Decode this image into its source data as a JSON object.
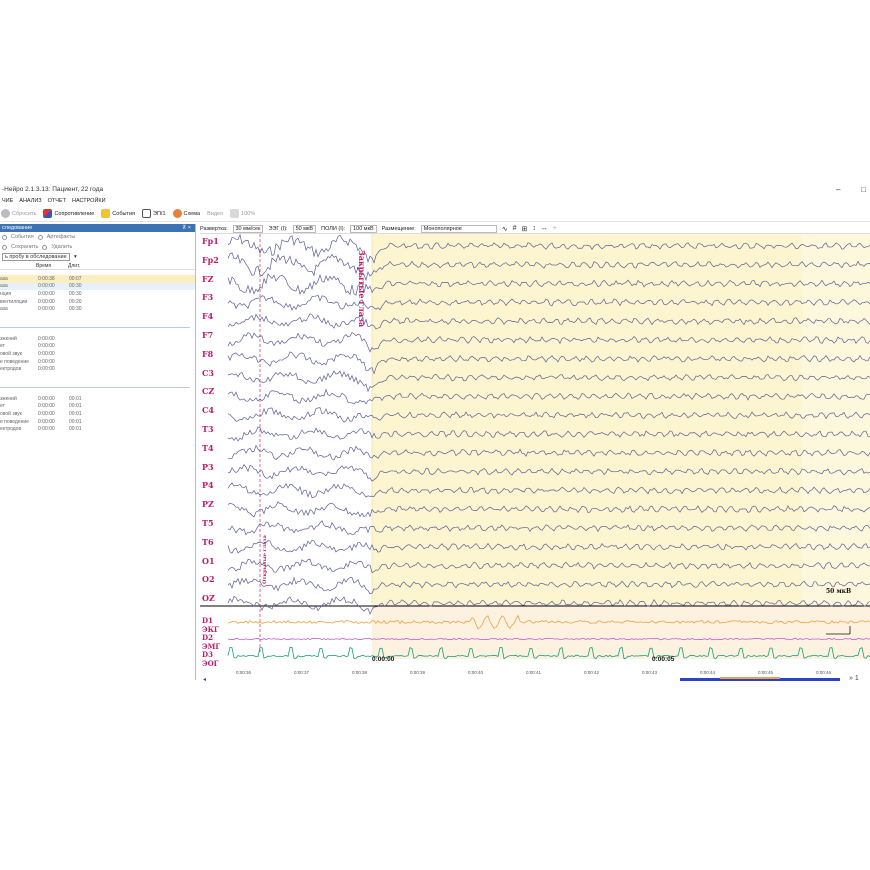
{
  "window": {
    "title": "-Нейро 2.1.3.13: Пациент, 22 года",
    "controls": [
      "–",
      "□"
    ]
  },
  "menu": [
    "ЧИЕ",
    "АНАЛИЗ",
    "ОТЧЕТ",
    "НАСТРОЙКИ"
  ],
  "toolbar": {
    "reset": "Сбросить",
    "impedance": "Сопротивление",
    "events": "События",
    "evp": "ЭП/1",
    "scheme": "Схема",
    "video": "Видео",
    "zoom": "100%"
  },
  "left_panel": {
    "header": "следование",
    "pin": "⊼ ×",
    "filters": [
      "События",
      "Артефакты"
    ],
    "actions": [
      "Сохранить",
      "Удалить"
    ],
    "add_button": "ь пробу в обследование",
    "columns": [
      "",
      "Время",
      "Длит."
    ],
    "group1": [
      {
        "name": "аза",
        "time": "0:00:38",
        "dur": "00:07",
        "state": "sel"
      },
      {
        "name": "аза",
        "time": "0:00:00",
        "dur": "00:30",
        "state": "sel2"
      },
      {
        "name": "нция",
        "time": "0:00:00",
        "dur": "00:30",
        "state": ""
      },
      {
        "name": "вентиляции",
        "time": "0:00:00",
        "dur": "00:20",
        "state": ""
      },
      {
        "name": "аза",
        "time": "0:00:00",
        "dur": "00:30",
        "state": ""
      }
    ],
    "group2": [
      {
        "name": "зжений",
        "time": "0:00:00"
      },
      {
        "name": "ет",
        "time": "0:00:00"
      },
      {
        "name": "овой звук",
        "time": "0:00:00"
      },
      {
        "name": "е поведение",
        "time": "0:00:00"
      },
      {
        "name": "ектродов",
        "time": "0:00:00"
      }
    ],
    "group3": [
      {
        "name": "зжений",
        "time": "0:00:00",
        "dur": "00:01"
      },
      {
        "name": "ет",
        "time": "0:00:00",
        "dur": "00:01"
      },
      {
        "name": "овой звук",
        "time": "0:00:00",
        "dur": "00:01"
      },
      {
        "name": "е поведение",
        "time": "0:00:00",
        "dur": "00:01"
      },
      {
        "name": "ектродов",
        "time": "0:00:00",
        "dur": "00:01"
      }
    ]
  },
  "controls": {
    "sweep_label": "Развертка:",
    "sweep_value": "30 мм/сек",
    "eeg_label": "ЭЭГ (I):",
    "eeg_value": "50 мкВ",
    "poly_label": "ПОЛИ (I):",
    "poly_value": "100 мкВ",
    "montage_label": "Размещение:",
    "montage_value": "Монополярное"
  },
  "channels": [
    "Fp1",
    "Fp2",
    "FZ",
    "F3",
    "F4",
    "F7",
    "F8",
    "C3",
    "CZ",
    "C4",
    "T3",
    "T4",
    "P3",
    "P4",
    "PZ",
    "T5",
    "T6",
    "O1",
    "O2",
    "OZ"
  ],
  "poly_channels": [
    "D1  ЭКГ",
    "D2  ЭМГ",
    "D3  ЭОГ"
  ],
  "annotations": {
    "eyes_closed": "Закрытые глаза",
    "marker": "Открытые глаза",
    "scale": "50 мкВ"
  },
  "time_axis": {
    "ticks": [
      "0:00:36",
      "0:00:37",
      "0:00:38",
      "0:00:39",
      "0:00:40",
      "0:00:41",
      "0:00:42",
      "0:00:43",
      "0:00:44",
      "0:00:45",
      "0:00:46"
    ],
    "major": [
      "0:00:00",
      "0:00:05"
    ]
  },
  "scroll": {
    "right_label": "» 1"
  }
}
